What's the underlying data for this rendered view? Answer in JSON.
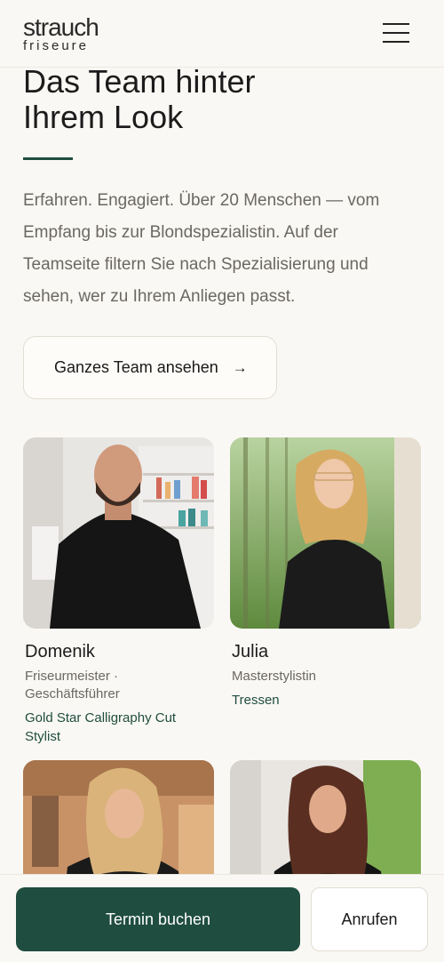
{
  "header": {
    "logo_top": "strauch",
    "logo_bottom": "friseure",
    "menu_icon": "hamburger-menu-icon"
  },
  "hero": {
    "title_line1": "Das Team hinter",
    "title_line2": "Ihrem Look",
    "intro": "Erfahren. Engagiert. Über 20 Menschen — vom Empfang bis zur Blondspezialistin. Auf der Teamseite filtern Sie nach Spezialisierung und sehen, wer zu Ihrem Anliegen passt.",
    "team_button_label": "Ganzes Team ansehen",
    "team_button_arrow": "→"
  },
  "team": [
    {
      "name": "Domenik",
      "role": "Friseurmeister · Geschäftsführer",
      "specialty": "Gold Star Calligraphy Cut Stylist"
    },
    {
      "name": "Julia",
      "role": "Masterstylistin",
      "specialty": "Tressen"
    },
    {
      "name": "",
      "role": "",
      "specialty": ""
    },
    {
      "name": "",
      "role": "",
      "specialty": ""
    }
  ],
  "footer_bar": {
    "book_label": "Termin buchen",
    "call_label": "Anrufen"
  },
  "colors": {
    "accent": "#1f4d3f",
    "background": "#faf8f4",
    "text_muted": "#6b6862"
  }
}
